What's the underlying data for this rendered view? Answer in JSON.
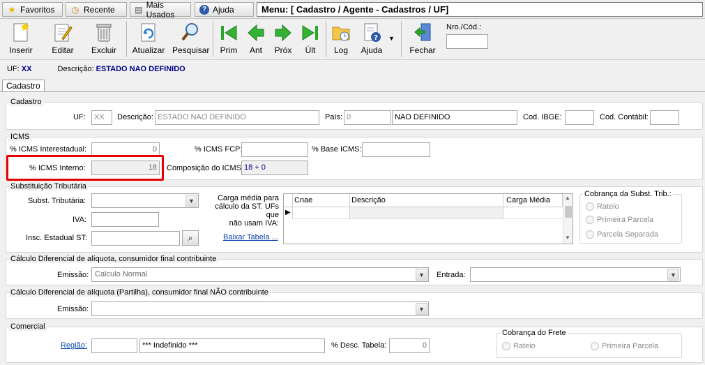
{
  "topbar": {
    "favoritos": "Favoritos",
    "recente": "Recente",
    "mais_usados": "Mais Usados",
    "ajuda": "Ajuda",
    "menu": "Menu: [ Cadastro / Agente - Cadastros / UF]"
  },
  "toolbar": {
    "inserir": "Inserir",
    "editar": "Editar",
    "excluir": "Excluir",
    "atualizar": "Atualizar",
    "pesquisar": "Pesquisar",
    "prim": "Prim",
    "ant": "Ant",
    "prox": "Próx",
    "ult": "Últ",
    "log": "Log",
    "ajuda": "Ajuda",
    "fechar": "Fechar",
    "nro_label": "Nro./Cód.:",
    "nro_value": ""
  },
  "info": {
    "uf_label": "UF:",
    "uf_value": "XX",
    "desc_label": "Descrição:",
    "desc_value": "ESTADO NAO DEFINIDO"
  },
  "tab": "Cadastro",
  "cadastro": {
    "title": "Cadastro",
    "uf_label": "UF:",
    "uf_value": "XX",
    "desc_label": "Descrição:",
    "desc_value": "ESTADO NAO DEFINIDO",
    "pais_label": "País:",
    "pais_code": "0",
    "pais_name": "NAO DEFINIDO",
    "ibge_label": "Cod. IBGE:",
    "ibge_value": "",
    "contabil_label": "Cod. Contábil:",
    "contabil_value": ""
  },
  "icms": {
    "title": "ICMS",
    "inter_label": "% ICMS Interestadual:",
    "inter_value": "0",
    "fcp_label": "% ICMS FCP:",
    "fcp_value": "",
    "base_label": "% Base ICMS:",
    "base_value": "",
    "interno_label": "% ICMS Interno:",
    "interno_value": "18",
    "comp_label": "Composição do ICMS:",
    "comp_value": "18 + 0"
  },
  "st": {
    "title": "Substituição Tributária",
    "subst_label": "Subst. Tributária:",
    "subst_value": "",
    "iva_label": "IVA:",
    "iva_value": "",
    "insc_label": "Insc. Estadual ST:",
    "insc_value": "",
    "carga_label_1": "Carga média para",
    "carga_label_2": "cálculo da ST. UFs que",
    "carga_label_3": "não usam IVA:",
    "baixar": "Baixar Tabela ...",
    "grid_cols": [
      "Cnae",
      "Descrição",
      "Carga Média"
    ],
    "cobranca_title": "Cobrança da Subst. Trib.:",
    "rateio": "Rateio",
    "primeira": "Primeira Parcela",
    "separada": "Parcela Separada"
  },
  "difal1": {
    "title": "Cálculo Diferencial de alíquota, consumidor final contribuinte",
    "emissao_label": "Emissão:",
    "emissao_value": "Calculo Normal",
    "entrada_label": "Entrada:",
    "entrada_value": ""
  },
  "difal2": {
    "title": "Cálculo Diferencial de alíquota (Partilha), consumidor final NÃO contribuinte",
    "emissao_label": "Emissão:",
    "emissao_value": ""
  },
  "comercial": {
    "title": "Comercial",
    "regiao_label": "Região:",
    "regiao_code": "",
    "regiao_name": "*** Indefinido ***",
    "desc_tabela_label": "% Desc. Tabela:",
    "desc_tabela_value": "0",
    "frete_title": "Cobrança do Frete",
    "rateio": "Rateio",
    "primeira": "Primeira Parcela"
  },
  "colors": {
    "highlight": "#e60000",
    "link": "#0645ad",
    "info_value": "#00008b"
  }
}
